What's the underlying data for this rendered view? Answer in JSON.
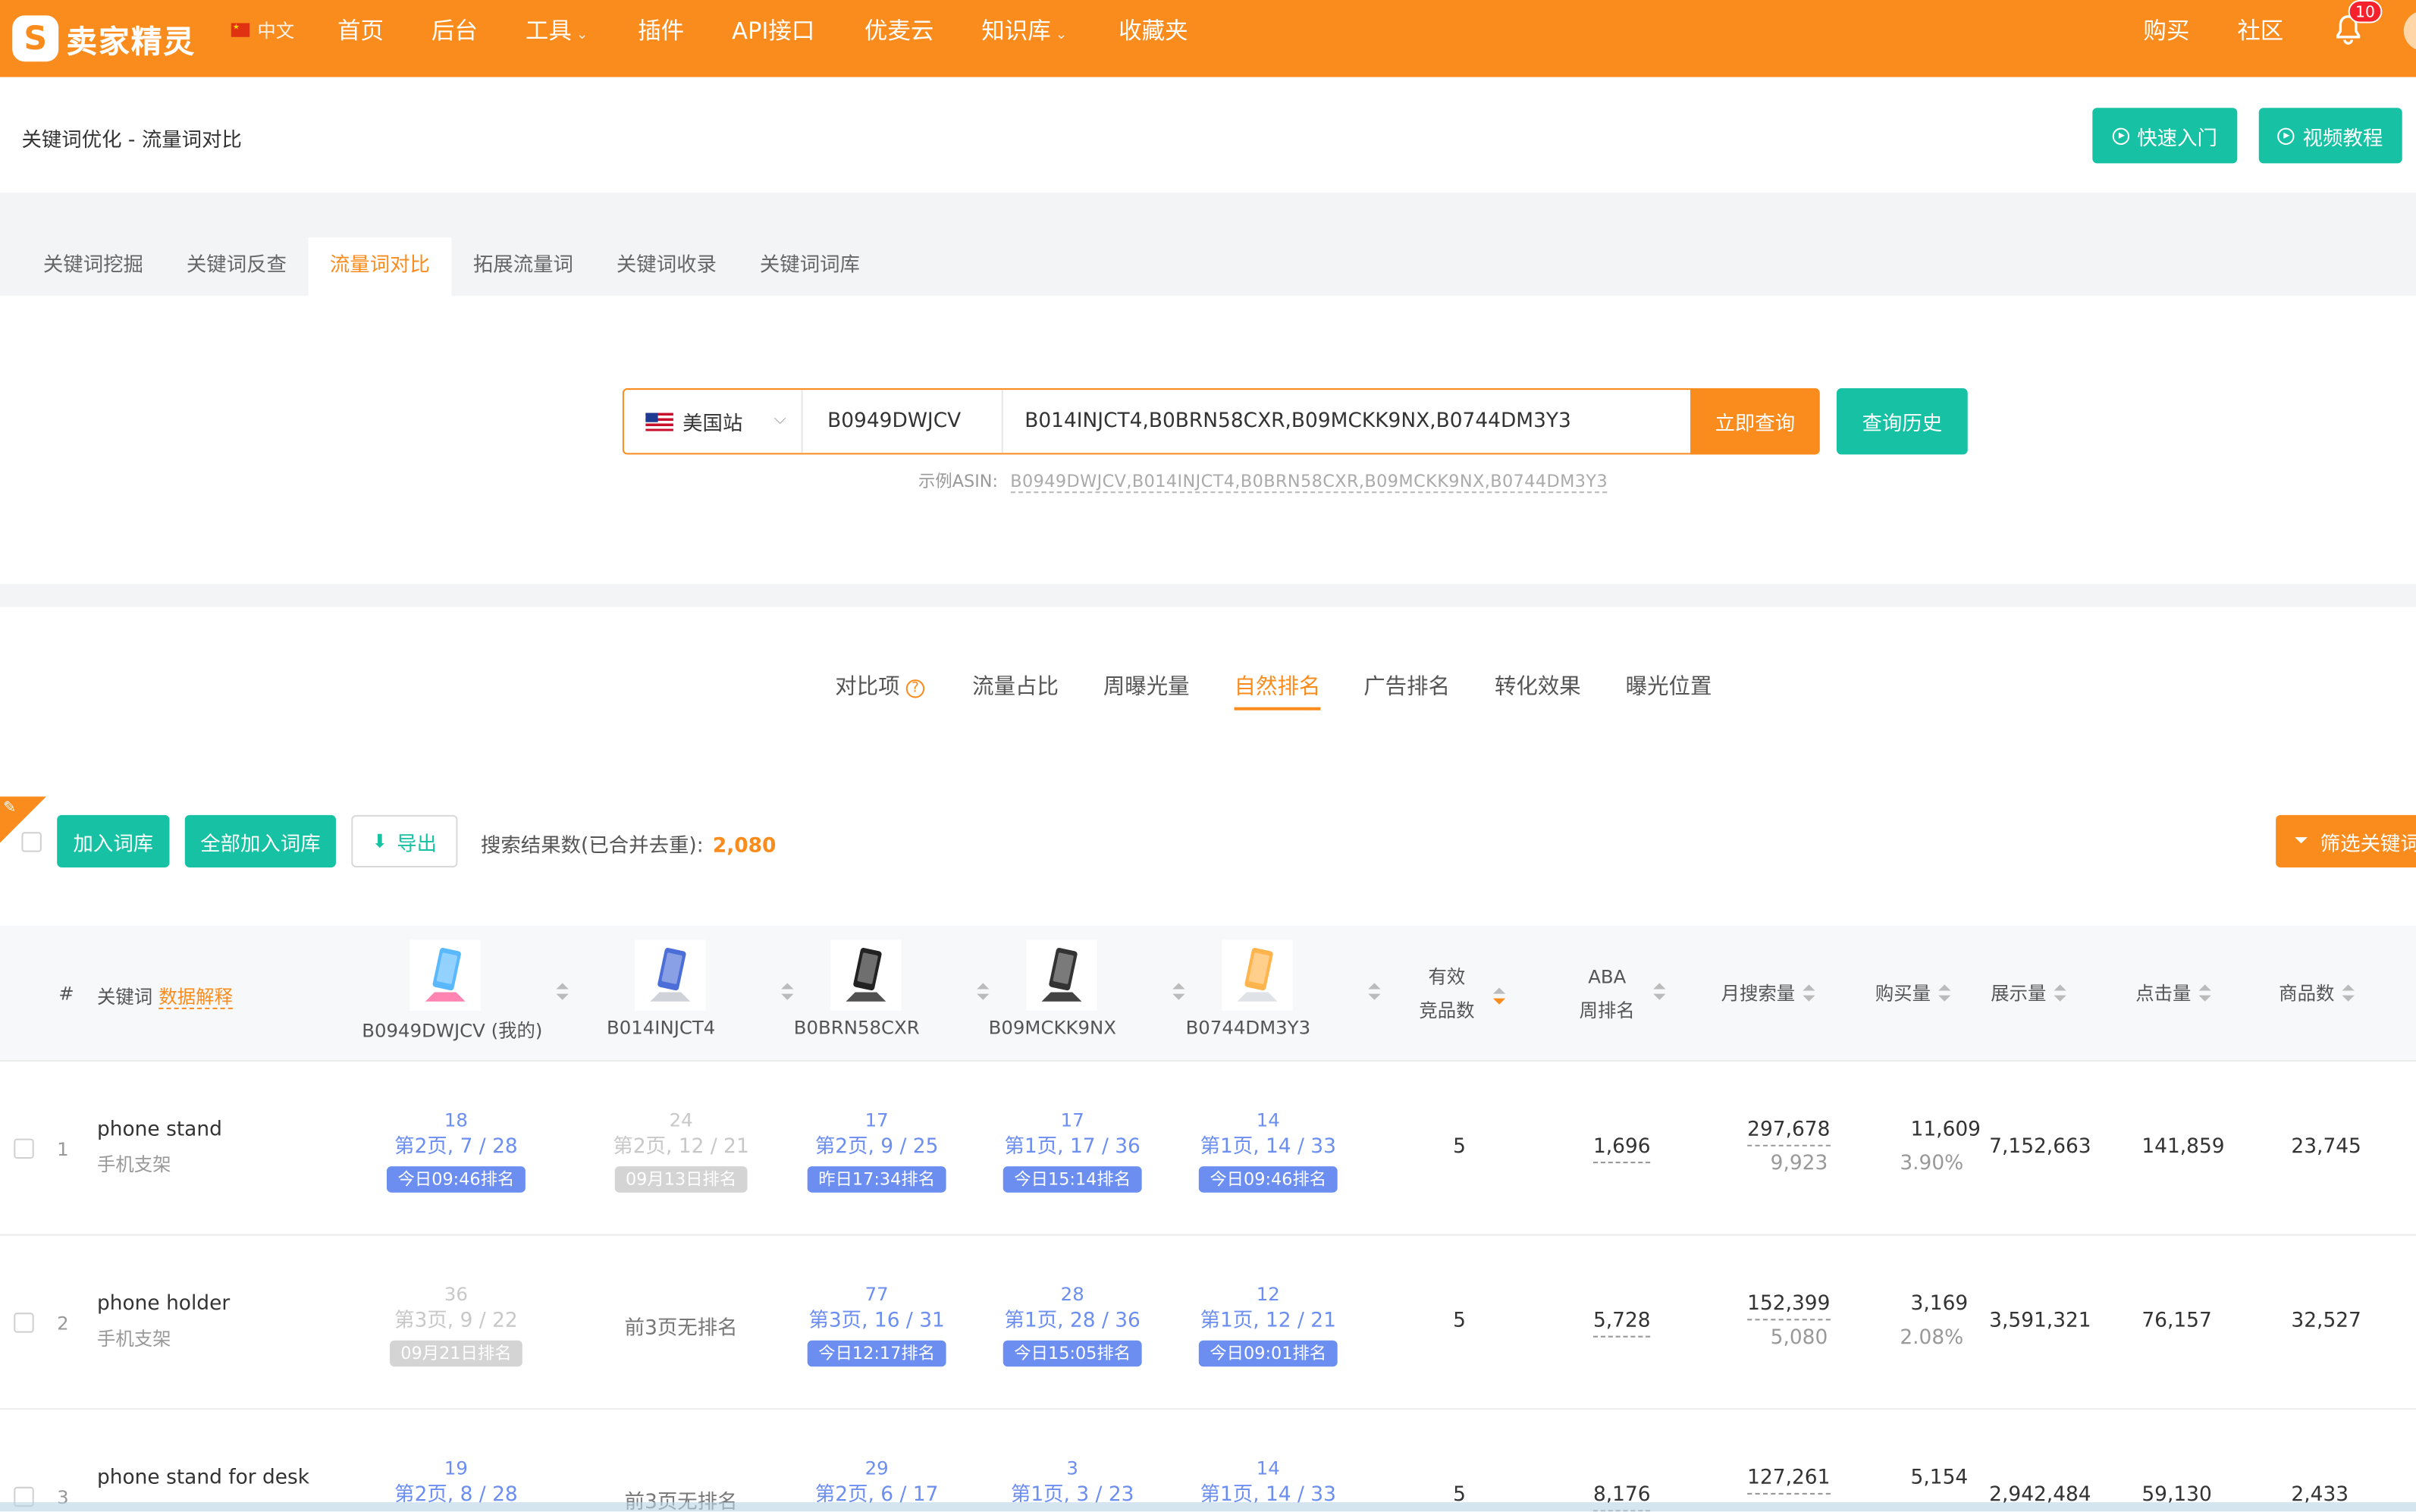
{
  "nav": {
    "logo_text": "卖家精灵",
    "lang": "中文",
    "items": [
      {
        "label": "首页",
        "caret": false
      },
      {
        "label": "后台",
        "caret": false
      },
      {
        "label": "工具",
        "caret": true
      },
      {
        "label": "插件",
        "caret": false
      },
      {
        "label": "API接口",
        "caret": false
      },
      {
        "label": "优麦云",
        "caret": false
      },
      {
        "label": "知识库",
        "caret": true
      },
      {
        "label": "收藏夹",
        "caret": false
      }
    ],
    "right": [
      "购买",
      "社区"
    ],
    "notification_count": "10"
  },
  "header": {
    "title": "关键词优化 - 流量词对比",
    "quick_start": "快速入门",
    "video_tutorial": "视频教程"
  },
  "tabs": [
    "关键词挖掘",
    "关键词反查",
    "流量词对比",
    "拓展流量词",
    "关键词收录",
    "关键词词库"
  ],
  "active_tab": 2,
  "search": {
    "site": "美国站",
    "my_asin": "B0949DWJCV",
    "competitor_asins": "B014INJCT4,B0BRN58CXR,B09MCKK9NX,B0744DM3Y3",
    "query_button": "立即查询",
    "history_button": "查询历史",
    "example_label": "示例ASIN:",
    "example_asins": "B0949DWJCV,B014INJCT4,B0BRN58CXR,B09MCKK9NX,B0744DM3Y3"
  },
  "compare_tabs": {
    "label": "对比项",
    "items": [
      "流量占比",
      "周曝光量",
      "自然排名",
      "广告排名",
      "转化效果",
      "曝光位置"
    ],
    "active": 2
  },
  "toolbar": {
    "add_to_library": "加入词库",
    "add_all": "全部加入词库",
    "export": "导出",
    "result_label": "搜索结果数(已合并去重):",
    "result_count": "2,080",
    "filter": "筛选关键词"
  },
  "table": {
    "headers": {
      "index": "#",
      "keyword": "关键词",
      "keyword_help": "数据解释",
      "valid_line1": "有效",
      "valid_line2": "竞品数",
      "aba_line1": "ABA",
      "aba_line2": "周排名",
      "monthly_search": "月搜索量",
      "purchases": "购买量",
      "impressions": "展示量",
      "clicks": "点击量",
      "products": "商品数"
    },
    "asins": [
      "B0949DWJCV (我的)",
      "B014INJCT4",
      "B0BRN58CXR",
      "B09MCKK9NX",
      "B0744DM3Y3"
    ],
    "rows": [
      {
        "index": "1",
        "kw_en": "phone stand",
        "kw_cn": "手机支架",
        "ranks": [
          {
            "pos": "18",
            "page": "第2页, 7 / 28",
            "tag": "今日09:46排名",
            "old": false
          },
          {
            "pos": "24",
            "page": "第2页, 12 / 21",
            "tag": "09月13日排名",
            "old": true
          },
          {
            "pos": "17",
            "page": "第2页, 9 / 25",
            "tag": "昨日17:34排名",
            "old": false
          },
          {
            "pos": "17",
            "page": "第1页, 17 / 36",
            "tag": "今日15:14排名",
            "old": false
          },
          {
            "pos": "14",
            "page": "第1页, 14 / 33",
            "tag": "今日09:46排名",
            "old": false
          }
        ],
        "valid": "5",
        "aba": "1,696",
        "monthly": "297,678",
        "monthly_sub": "9,923",
        "purchases": "11,609",
        "purchase_rate": "3.90%",
        "impressions": "7,152,663",
        "clicks": "141,859",
        "products": "23,745"
      },
      {
        "index": "2",
        "kw_en": "phone holder",
        "kw_cn": "手机支架",
        "ranks": [
          {
            "pos": "36",
            "page": "第3页, 9 / 22",
            "tag": "09月21日排名",
            "old": true
          },
          {
            "none": "前3页无排名"
          },
          {
            "pos": "77",
            "page": "第3页, 16 / 31",
            "tag": "今日12:17排名",
            "old": false
          },
          {
            "pos": "28",
            "page": "第1页, 28 / 36",
            "tag": "今日15:05排名",
            "old": false
          },
          {
            "pos": "12",
            "page": "第1页, 12 / 21",
            "tag": "今日09:01排名",
            "old": false
          }
        ],
        "valid": "5",
        "aba": "5,728",
        "monthly": "152,399",
        "monthly_sub": "5,080",
        "purchases": "3,169",
        "purchase_rate": "2.08%",
        "impressions": "3,591,321",
        "clicks": "76,157",
        "products": "32,527"
      },
      {
        "index": "3",
        "kw_en": "phone stand for desk",
        "kw_cn": "",
        "ranks": [
          {
            "pos": "19",
            "page": "第2页, 8 / 28",
            "tag": "",
            "old": false
          },
          {
            "none": "前3页无排名"
          },
          {
            "pos": "29",
            "page": "第2页, 6 / 17",
            "tag": "",
            "old": false
          },
          {
            "pos": "3",
            "page": "第1页, 3 / 23",
            "tag": "",
            "old": false
          },
          {
            "pos": "14",
            "page": "第1页, 14 / 33",
            "tag": "",
            "old": false
          }
        ],
        "valid": "5",
        "aba": "8,176",
        "monthly": "127,261",
        "monthly_sub": "",
        "purchases": "5,154",
        "purchase_rate": "",
        "impressions": "2,942,484",
        "clicks": "59,130",
        "products": "2,433"
      }
    ]
  },
  "colors": {
    "brand": "#fa8c1e",
    "teal": "#16c2a3",
    "rank_blue": "#6b8ef0"
  }
}
